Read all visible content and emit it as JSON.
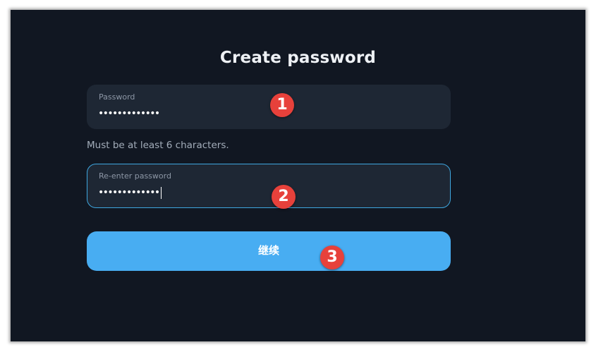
{
  "page": {
    "title": "Create password"
  },
  "password_field": {
    "label": "Password",
    "value": "•••••••••••••"
  },
  "hint": "Must be at least 6 characters.",
  "confirm_field": {
    "label": "Re-enter password",
    "value": "•••••••••••••"
  },
  "continue_button": {
    "label": "继续"
  },
  "markers": [
    "1",
    "2",
    "3"
  ],
  "colors": {
    "background": "#111722",
    "field": "#1e2734",
    "accent": "#48adf2",
    "focus_border": "#3ea7e0",
    "marker": "#e7413b"
  }
}
